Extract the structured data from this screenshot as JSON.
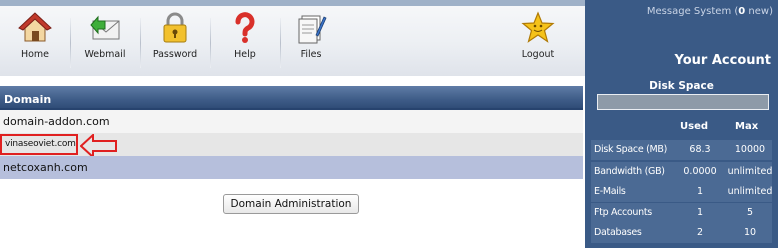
{
  "toolbar": {
    "items": [
      {
        "label": "Home",
        "icon": "home-icon"
      },
      {
        "label": "Webmail",
        "icon": "webmail-icon"
      },
      {
        "label": "Password",
        "icon": "lock-icon"
      },
      {
        "label": "Help",
        "icon": "help-icon"
      },
      {
        "label": "Files",
        "icon": "files-icon"
      },
      {
        "label": "Logout",
        "icon": "star-icon"
      }
    ]
  },
  "domains": {
    "header": "Domain",
    "rows": [
      "domain-addon.com",
      "vinaseoviet.com",
      "netcoxanh.com"
    ],
    "admin_button": "Domain Administration"
  },
  "panel": {
    "message_label": "Message System (",
    "message_count": "0",
    "message_suffix": " new)",
    "title": "Your Account",
    "disk_space_title": "Disk Space",
    "disk_space_used_fraction": 0.0,
    "col_used": "Used",
    "col_max": "Max",
    "stats": [
      {
        "label": "Disk Space (MB)",
        "used": "68.3",
        "max": "10000"
      },
      {
        "label": "Bandwidth (GB)",
        "used": "0.0000",
        "max": "unlimited"
      },
      {
        "label": "E-Mails",
        "used": "1",
        "max": "unlimited"
      },
      {
        "label": "Ftp Accounts",
        "used": "1",
        "max": "5"
      },
      {
        "label": "Databases",
        "used": "2",
        "max": "10"
      }
    ]
  },
  "colors": {
    "panel_bg": "#3a5a86",
    "header_bg": "#3f5d88",
    "highlight": "#e02020",
    "selected_row": "#b6bfdc"
  }
}
